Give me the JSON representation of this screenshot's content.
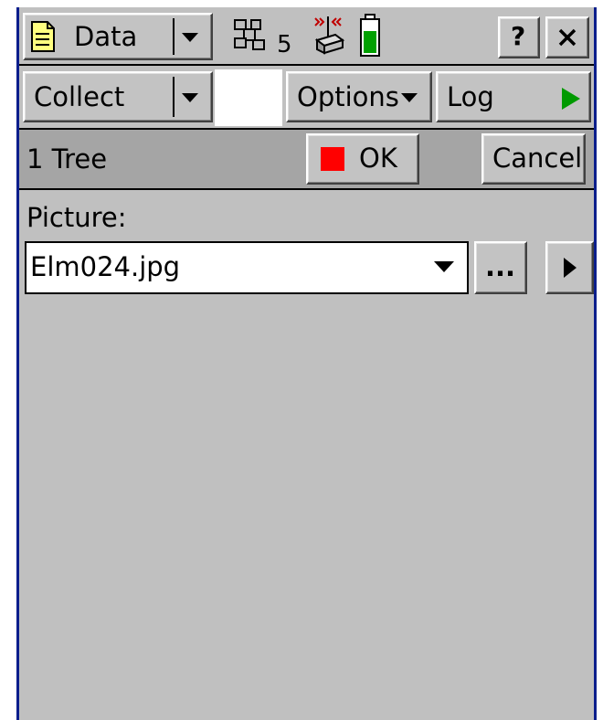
{
  "header": {
    "menu_label": "Data",
    "satellite_count": "5"
  },
  "toolbar": {
    "mode_label": "Collect",
    "options_label": "Options",
    "log_label": "Log"
  },
  "form": {
    "feature_title": "1 Tree",
    "ok_label": "OK",
    "cancel_label": "Cancel",
    "field_label": "Picture:",
    "field_value": "Elm024.jpg",
    "browse_label": "..."
  },
  "colors": {
    "ok_indicator": "#ff0000",
    "log_play": "#009a00",
    "battery": "#00a000",
    "window_border": "#0a1e8c"
  }
}
